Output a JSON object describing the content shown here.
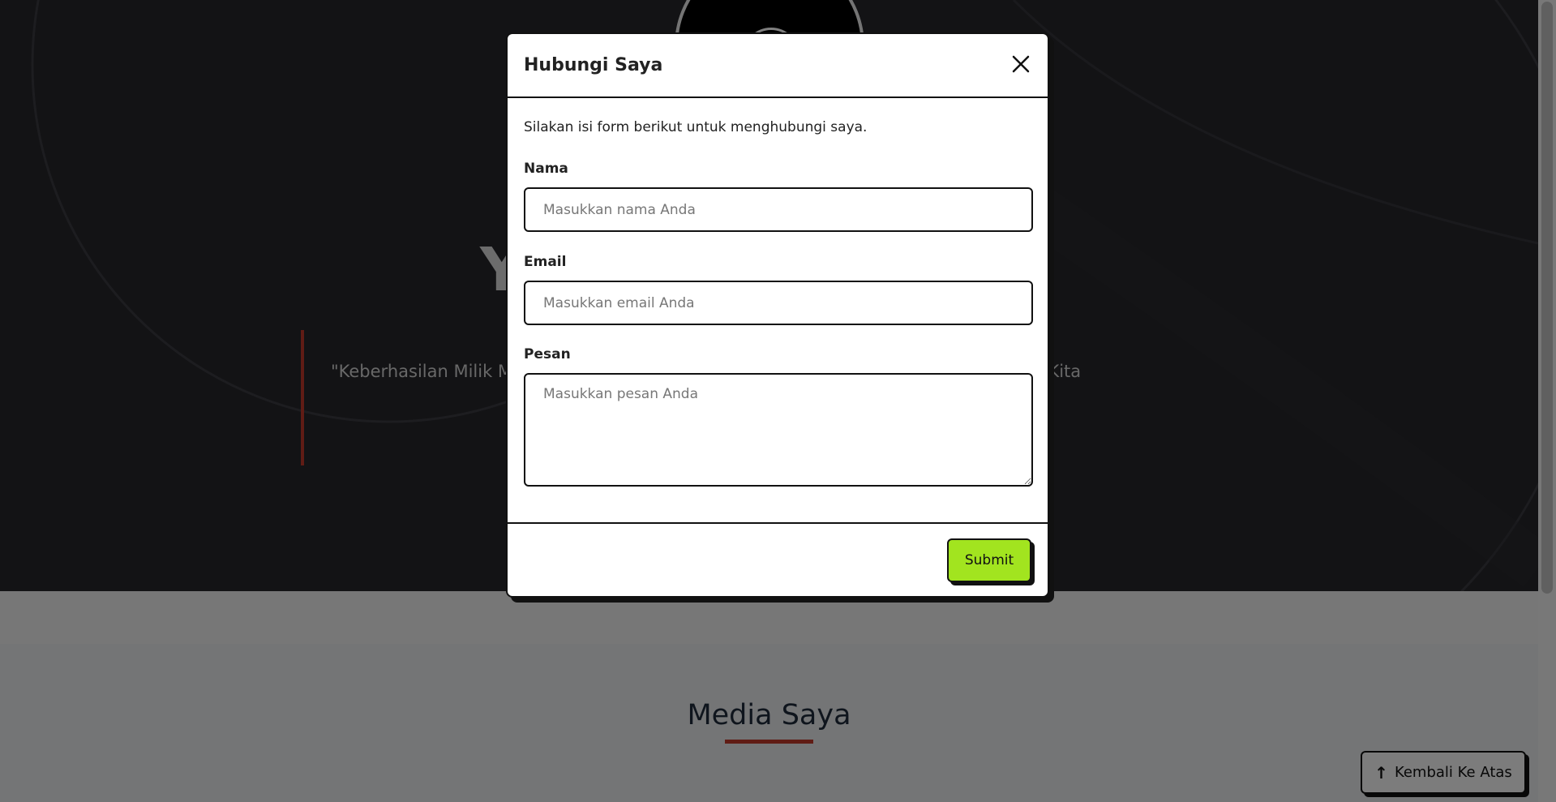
{
  "hero": {
    "title": "YUDI ANDRI YAN",
    "quote": "\"Keberhasilan Milik Mereka Yang Berani Bermimpi Dan Berjuang Untuk Masa Depan Kita"
  },
  "media": {
    "title": "Media Saya"
  },
  "back_to_top": {
    "label": "Kembali Ke Atas",
    "icon": "arrow-up-icon"
  },
  "modal": {
    "title": "Hubungi Saya",
    "close_icon": "close-icon",
    "intro": "Silakan isi form berikut untuk menghubungi saya.",
    "fields": {
      "name": {
        "label": "Nama",
        "placeholder": "Masukkan nama Anda",
        "value": ""
      },
      "email": {
        "label": "Email",
        "placeholder": "Masukkan email Anda",
        "value": ""
      },
      "message": {
        "label": "Pesan",
        "placeholder": "Masukkan pesan Anda",
        "value": ""
      }
    },
    "submit_label": "Submit"
  },
  "colors": {
    "accent_green": "#a2e41f",
    "accent_red": "#c0392b",
    "hero_bg": "#26262a"
  }
}
